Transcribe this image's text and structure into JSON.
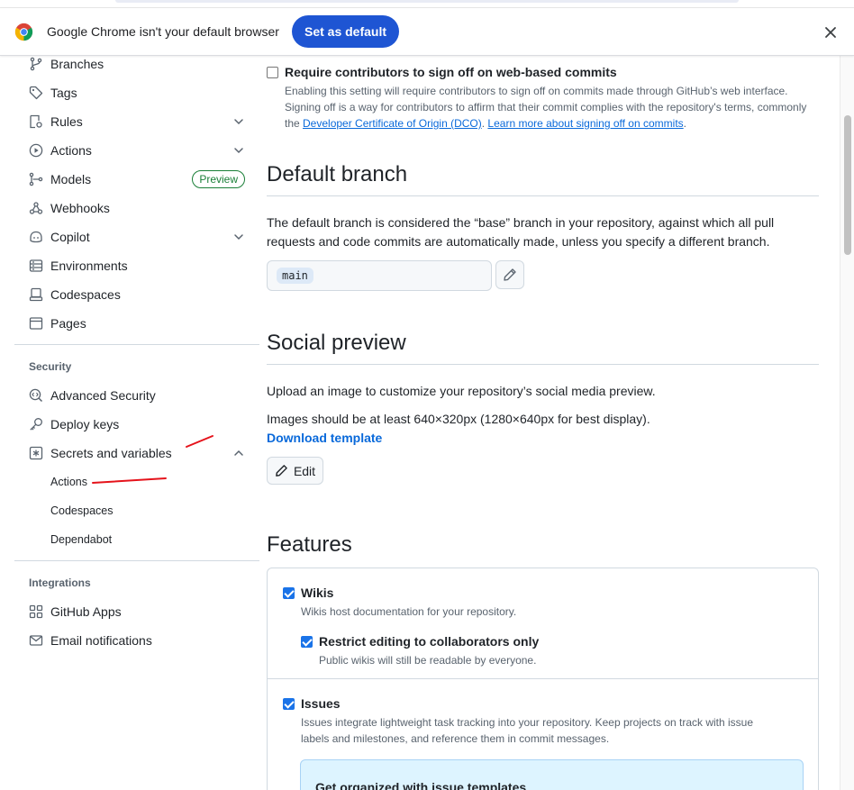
{
  "infobar": {
    "message": "Google Chrome isn't your default browser",
    "set_default_label": "Set as default"
  },
  "sidebar": {
    "items": [
      {
        "label": "Branches",
        "icon": "git-branch-icon"
      },
      {
        "label": "Tags",
        "icon": "tag-icon"
      },
      {
        "label": "Rules",
        "icon": "rules-icon"
      },
      {
        "label": "Actions",
        "icon": "play-icon"
      },
      {
        "label": "Models",
        "icon": "models-icon",
        "badge": "Preview"
      },
      {
        "label": "Webhooks",
        "icon": "webhook-icon"
      },
      {
        "label": "Copilot",
        "icon": "copilot-icon"
      },
      {
        "label": "Environments",
        "icon": "server-icon"
      },
      {
        "label": "Codespaces",
        "icon": "codespaces-icon"
      },
      {
        "label": "Pages",
        "icon": "browser-icon"
      }
    ],
    "security_heading": "Security",
    "security_items": [
      {
        "label": "Advanced Security",
        "icon": "codescan-icon"
      },
      {
        "label": "Deploy keys",
        "icon": "key-icon"
      },
      {
        "label": "Secrets and variables",
        "icon": "asterisk-icon"
      }
    ],
    "secrets_sub": [
      "Actions",
      "Codespaces",
      "Dependabot"
    ],
    "integrations_heading": "Integrations",
    "integrations_items": [
      {
        "label": "GitHub Apps",
        "icon": "apps-icon"
      },
      {
        "label": "Email notifications",
        "icon": "mail-icon"
      }
    ]
  },
  "signoff": {
    "title": "Require contributors to sign off on web-based commits",
    "desc_1": "Enabling this setting will require contributors to sign off on commits made through GitHub’s web interface. Signing off is a way for contributors to affirm that their commit complies with the repository's terms, commonly the ",
    "dco_link": "Developer Certificate of Origin (DCO)",
    "desc_2": ". ",
    "learn_link": "Learn more about signing off on commits",
    "desc_3": ".",
    "checked": false
  },
  "default_branch": {
    "title": "Default branch",
    "desc": "The default branch is considered the “base” branch in your repository, against which all pull requests and code commits are automatically made, unless you specify a different branch.",
    "branch": "main"
  },
  "social_preview": {
    "title": "Social preview",
    "desc": "Upload an image to customize your repository’s social media preview.",
    "size_hint": "Images should be at least 640×320px (1280×640px for best display).",
    "download_link": "Download template",
    "edit_label": "Edit"
  },
  "features": {
    "title": "Features",
    "wikis": {
      "title": "Wikis",
      "desc": "Wikis host documentation for your repository.",
      "checked": true
    },
    "restrict": {
      "title": "Restrict editing to collaborators only",
      "desc": "Public wikis will still be readable by everyone.",
      "checked": true
    },
    "issues": {
      "title": "Issues",
      "desc_line1": "Issues integrate lightweight task tracking into your repository. Keep projects on track with issue",
      "desc_line2": "labels and milestones, and reference them in commit messages.",
      "checked": true
    },
    "templates_title": "Get organized with issue templates"
  },
  "colors": {
    "accent": "#0969da",
    "chrome_button": "#1e55d3",
    "preview_badge": "#1a7f37",
    "annotation": "#e5131b"
  }
}
